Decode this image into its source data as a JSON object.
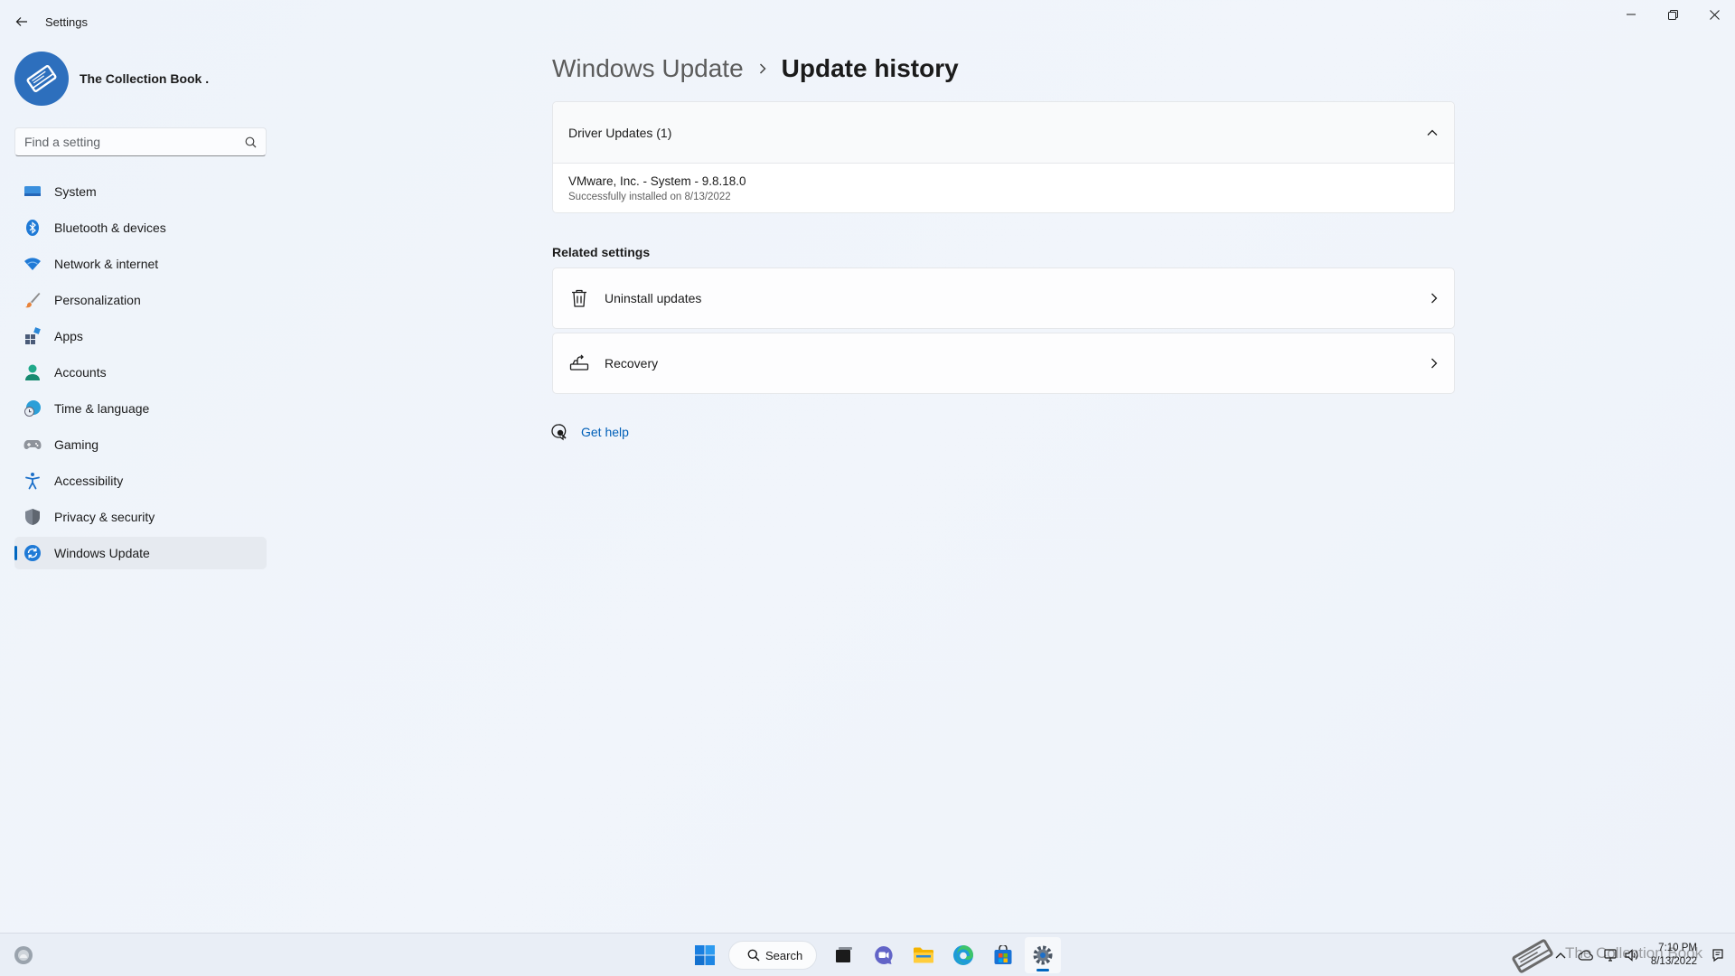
{
  "window": {
    "app_title": "Settings",
    "minimize_icon": "minimize-icon",
    "maximize_icon": "restore-icon",
    "close_icon": "close-icon"
  },
  "profile": {
    "name": "The Collection Book ."
  },
  "search": {
    "placeholder": "Find a setting"
  },
  "sidebar": {
    "items": [
      {
        "label": "System",
        "icon": "system-icon"
      },
      {
        "label": "Bluetooth & devices",
        "icon": "bluetooth-icon"
      },
      {
        "label": "Network & internet",
        "icon": "wifi-icon"
      },
      {
        "label": "Personalization",
        "icon": "brush-icon"
      },
      {
        "label": "Apps",
        "icon": "apps-icon"
      },
      {
        "label": "Accounts",
        "icon": "person-icon"
      },
      {
        "label": "Time & language",
        "icon": "globe-clock-icon"
      },
      {
        "label": "Gaming",
        "icon": "gamepad-icon"
      },
      {
        "label": "Accessibility",
        "icon": "accessibility-icon"
      },
      {
        "label": "Privacy & security",
        "icon": "shield-icon"
      },
      {
        "label": "Windows Update",
        "icon": "update-icon",
        "active": true
      }
    ]
  },
  "breadcrumb": {
    "parent": "Windows Update",
    "current": "Update history"
  },
  "driver_updates": {
    "title": "Driver Updates (1)",
    "expanded": true,
    "items": [
      {
        "name": "VMware, Inc. - System - 9.8.18.0",
        "status": "Successfully installed on 8/13/2022"
      }
    ]
  },
  "related_settings": {
    "title": "Related settings",
    "items": [
      {
        "label": "Uninstall updates",
        "icon": "trash-icon"
      },
      {
        "label": "Recovery",
        "icon": "recovery-icon"
      }
    ]
  },
  "help": {
    "label": "Get help"
  },
  "taskbar": {
    "search_label": "Search",
    "watermark": "The Collection Book",
    "time": "7:10 PM",
    "date": "8/13/2022"
  },
  "colors": {
    "accent": "#0067c0",
    "link": "#005fb8",
    "background": "#eef3fa"
  }
}
